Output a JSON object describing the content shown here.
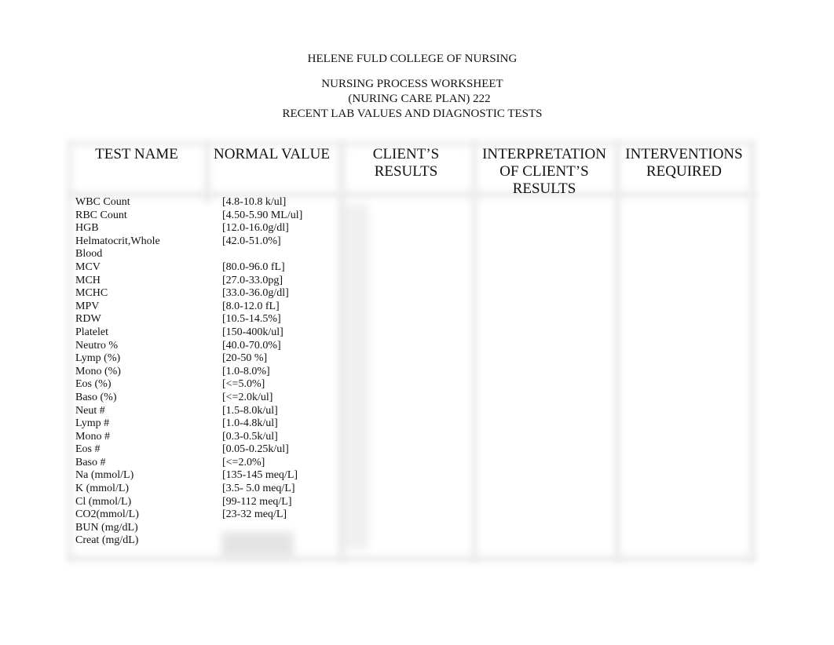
{
  "header": {
    "institution": "HELENE FULD COLLEGE OF NURSING",
    "worksheet_title": "NURSING PROCESS WORKSHEET",
    "care_plan": "(NURING CARE PLAN) 222",
    "section_title": "RECENT LAB VALUES AND DIAGNOSTIC TESTS"
  },
  "table": {
    "columns": [
      {
        "line1": "TEST NAME",
        "line2": "",
        "line3": ""
      },
      {
        "line1": "NORMAL VALUE",
        "line2": "",
        "line3": ""
      },
      {
        "line1": "CLIENT’S",
        "line2": "RESULTS",
        "line3": ""
      },
      {
        "line1": "INTERPRETATION",
        "line2": "OF CLIENT’S",
        "line3": "RESULTS"
      },
      {
        "line1": "INTERVENTIONS",
        "line2": "REQUIRED",
        "line3": ""
      }
    ],
    "rows": [
      {
        "test": "WBC Count",
        "normal": "[4.8-10.8 k/ul]"
      },
      {
        "test": "RBC Count",
        "normal": "[4.50-5.90 ML/ul]"
      },
      {
        "test": "HGB",
        "normal": "[12.0-16.0g/dl]"
      },
      {
        "test": "Helmatocrit,Whole",
        "normal": "[42.0-51.0%]"
      },
      {
        "test": "Blood",
        "normal": ""
      },
      {
        "test": "MCV",
        "normal": "[80.0-96.0 fL]"
      },
      {
        "test": "MCH",
        "normal": "[27.0-33.0pg]"
      },
      {
        "test": "MCHC",
        "normal": "[33.0-36.0g/dl]"
      },
      {
        "test": "MPV",
        "normal": "[8.0-12.0 fL]"
      },
      {
        "test": "RDW",
        "normal": "[10.5-14.5%]"
      },
      {
        "test": "Platelet",
        "normal": "[150-400k/ul]"
      },
      {
        "test": "Neutro %",
        "normal": "[40.0-70.0%]"
      },
      {
        "test": "Lymp (%)",
        "normal": "[20-50 %]"
      },
      {
        "test": "Mono (%)",
        "normal": "[1.0-8.0%]"
      },
      {
        "test": "Eos (%)",
        "normal": "[<=5.0%]"
      },
      {
        "test": "Baso (%)",
        "normal": "[<=2.0k/ul]"
      },
      {
        "test": "Neut #",
        "normal": "[1.5-8.0k/ul]"
      },
      {
        "test": "Lymp #",
        "normal": "[1.0-4.8k/ul]"
      },
      {
        "test": "Mono #",
        "normal": "[0.3-0.5k/ul]"
      },
      {
        "test": "Eos #",
        "normal": "[0.05-0.25k/ul]"
      },
      {
        "test": "Baso #",
        "normal": "[<=2.0%]"
      },
      {
        "test": "Na (mmol/L)",
        "normal": "[135-145 meq/L]"
      },
      {
        "test": "K (mmol/L)",
        "normal": "[3.5- 5.0 meq/L]"
      },
      {
        "test": "Cl (mmol/L)",
        "normal": "[99-112 meq/L]"
      },
      {
        "test": "CO2(mmol/L)",
        "normal": "[23-32 meq/L]"
      },
      {
        "test": "BUN (mg/dL)",
        "normal": ""
      },
      {
        "test": "Creat (mg/dL)",
        "normal": ""
      }
    ]
  }
}
